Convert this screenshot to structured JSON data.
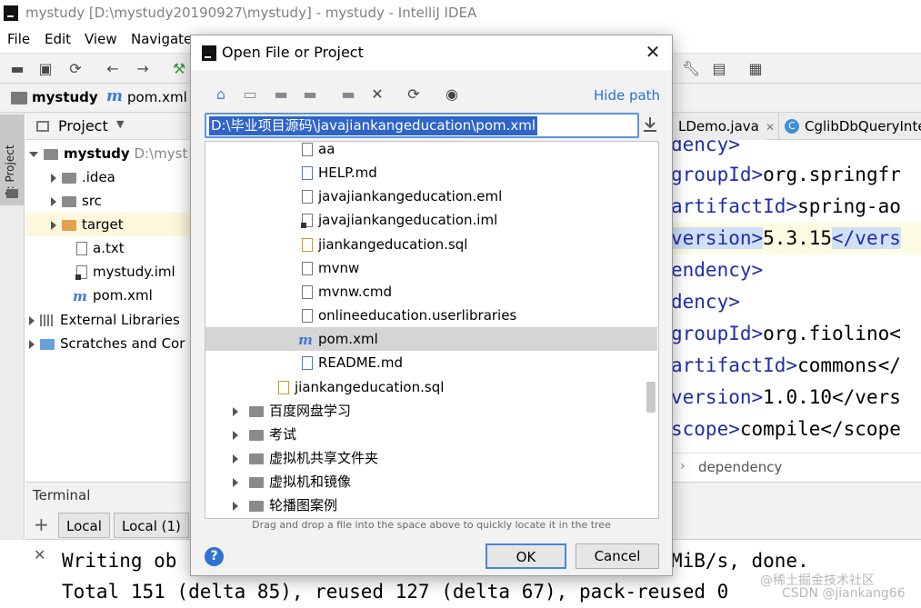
{
  "window": {
    "title": "mystudy [D:\\mystudy20190927\\mystudy] - mystudy - IntelliJ IDEA"
  },
  "menu": [
    "File",
    "Edit",
    "View",
    "Navigate"
  ],
  "navbar": {
    "project": "mystudy",
    "file": "pom.xml"
  },
  "left_strip": {
    "label": "1: Project"
  },
  "project_panel": {
    "header": "Project",
    "root_name": "mystudy",
    "root_path": "D:\\myst",
    "items": [
      {
        "label": ".idea"
      },
      {
        "label": "src"
      },
      {
        "label": "target"
      },
      {
        "label": "a.txt"
      },
      {
        "label": "mystudy.iml"
      },
      {
        "label": "pom.xml"
      },
      {
        "label": "External Libraries"
      },
      {
        "label": "Scratches and Cor"
      }
    ]
  },
  "editor": {
    "tabs": [
      "LDemo.java",
      "CglibDbQueryInte"
    ],
    "lines": [
      {
        "tag": "dency>",
        "text": ""
      },
      {
        "tag": "groupId>",
        "text": "org.springfr"
      },
      {
        "tag": "artifactId>",
        "text": "spring-ao"
      },
      {
        "tag": "version>",
        "text": "5.3.15",
        "close": "</vers"
      },
      {
        "tag": "endency>",
        "text": ""
      },
      {
        "tag": "dency>",
        "text": ""
      },
      {
        "tag": "groupId>",
        "text": "org.fiolino<"
      },
      {
        "tag": "artifactId>",
        "text": "commons</"
      },
      {
        "tag": "version>",
        "text": "1.0.10</vers"
      },
      {
        "tag": "scope>",
        "text": "compile</scope"
      }
    ],
    "breadcrumb": "dependency"
  },
  "terminal": {
    "header": "Terminal",
    "tabs": [
      "Local",
      "Local (1)"
    ],
    "line1_start": "Writing ob",
    "line1_end": "MiB/s, done.",
    "line2": "Total 151 (delta 85), reused 127 (delta 67), pack-reused 0"
  },
  "watermark": "@稀土掘金技术社区",
  "watermark2": "CSDN @jiankang66",
  "dialog": {
    "title": "Open File or Project",
    "hide_path": "Hide path",
    "path_value": "D:\\毕业项目源码\\javajiankangeducation\\pom.xml",
    "files": [
      {
        "label": "aa",
        "icon": "file-icon"
      },
      {
        "label": "HELP.md",
        "icon": "md-icon"
      },
      {
        "label": "javajiankangeducation.eml",
        "icon": "file-icon"
      },
      {
        "label": "javajiankangeducation.iml",
        "icon": "iml-icon"
      },
      {
        "label": "jiankangeducation.sql",
        "icon": "sql-icon"
      },
      {
        "label": "mvnw",
        "icon": "file-icon"
      },
      {
        "label": "mvnw.cmd",
        "icon": "file-icon"
      },
      {
        "label": "onlineeducation.userlibraries",
        "icon": "file-icon"
      },
      {
        "label": "pom.xml",
        "icon": "maven-icon"
      },
      {
        "label": "README.md",
        "icon": "md-icon"
      }
    ],
    "sql_file": "jiankangeducation.sql",
    "folders": [
      "百度网盘学习",
      "考试",
      "虚拟机共享文件夹",
      "虚拟机和镜像",
      "轮播图案例"
    ],
    "hint": "Drag and drop a file into the space above to quickly locate it in the tree",
    "ok": "OK",
    "cancel": "Cancel",
    "help": "?"
  }
}
